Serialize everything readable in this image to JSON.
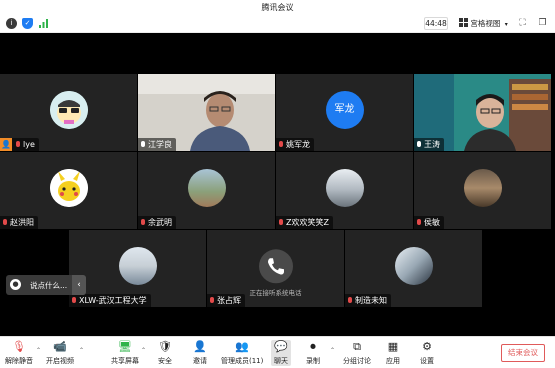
{
  "window": {
    "title": "腾讯会议"
  },
  "topbar": {
    "timer": "44:48",
    "view_label": "宫格视图",
    "icons": [
      "info-icon",
      "shield-icon",
      "signal-icon",
      "grid-icon",
      "chevron-down-icon",
      "fullscreen-icon",
      "layout-icon"
    ]
  },
  "participants": [
    {
      "name": "lye",
      "mic": "host",
      "avatar": "cartoon"
    },
    {
      "name": "江学良",
      "mic": "on",
      "avatar": "video"
    },
    {
      "name": "姚军龙",
      "mic": "muted",
      "avatar": "text",
      "avatar_text": "军龙",
      "avatar_color": "#1e7cf2"
    },
    {
      "name": "王涛",
      "mic": "on",
      "avatar": "video"
    },
    {
      "name": "赵洪阳",
      "mic": "muted",
      "avatar": "pikachu"
    },
    {
      "name": "余武明",
      "mic": "muted",
      "avatar": "photo"
    },
    {
      "name": "Z欢欢笑笑Z",
      "mic": "muted",
      "avatar": "photo"
    },
    {
      "name": "侯敏",
      "mic": "muted",
      "avatar": "photo"
    },
    {
      "name": "XLW-武汉工程大学",
      "mic": "muted",
      "avatar": "photo"
    },
    {
      "name": "张占辉",
      "mic": "muted",
      "avatar": "phone",
      "status": "正在接听系统电话"
    },
    {
      "name": "制造未知",
      "mic": "muted",
      "avatar": "photo"
    }
  ],
  "chat": {
    "preview": "说点什么...",
    "collapse": "‹"
  },
  "toolbar": {
    "unmute": "解除静音",
    "start_video": "开启视频",
    "share_screen": "共享屏幕",
    "security": "安全",
    "invite": "邀请",
    "manage_members": "管理成员(11)",
    "chat": "聊天",
    "record": "录制",
    "breakout": "分组讨论",
    "apps": "应用",
    "settings": "设置",
    "end_meeting": "结束会议"
  },
  "colors": {
    "accent_green": "#44c767",
    "end_red": "#e05a5a",
    "brand_blue": "#1e7cf2"
  }
}
